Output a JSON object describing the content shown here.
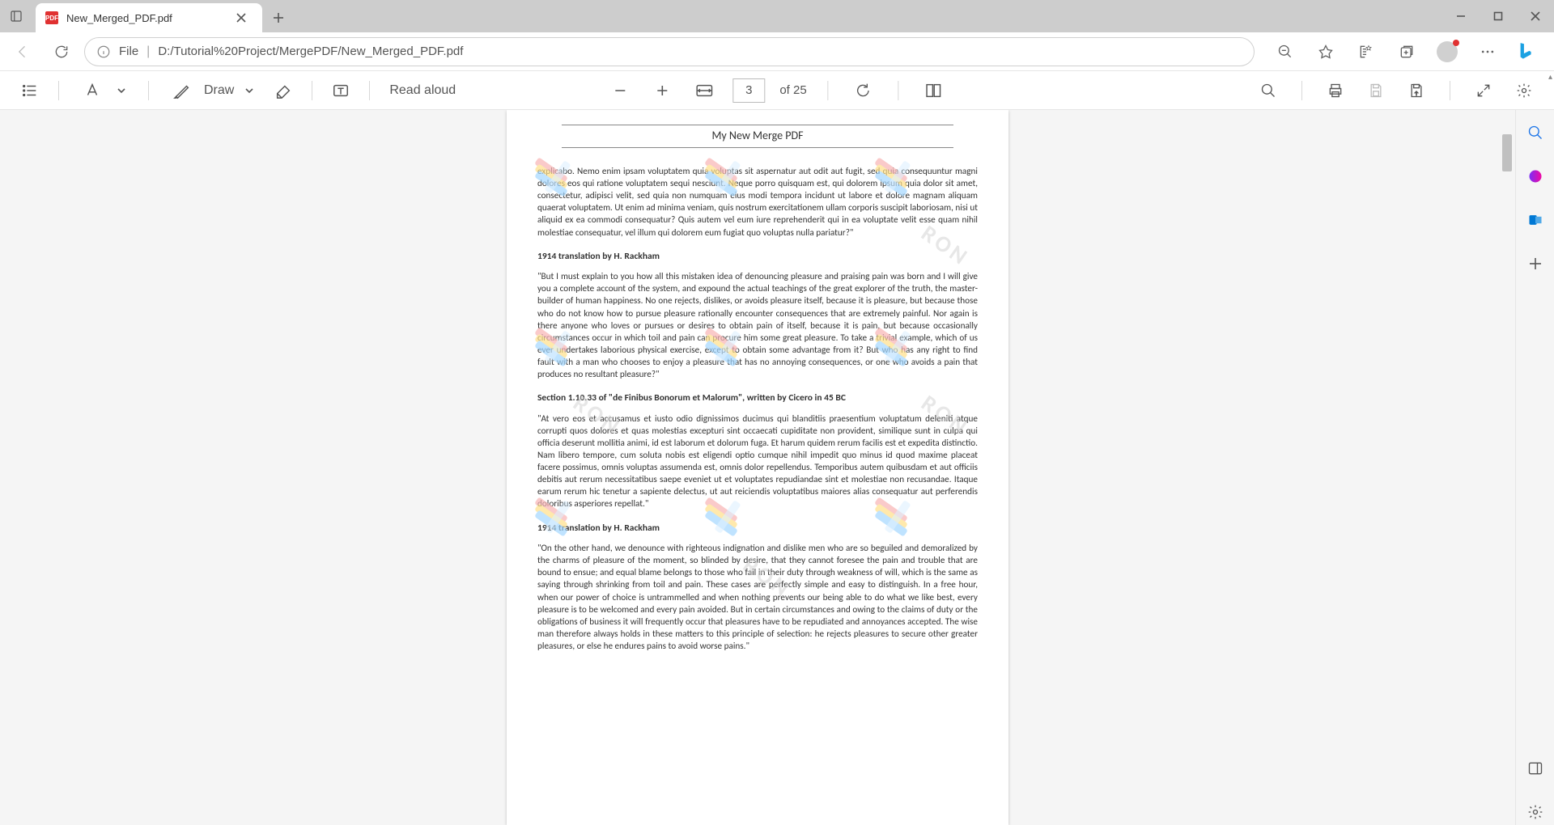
{
  "tab": {
    "title": "New_Merged_PDF.pdf",
    "badge": "PDF"
  },
  "address": {
    "scheme": "File",
    "url": "D:/Tutorial%20Project/MergePDF/New_Merged_PDF.pdf"
  },
  "pdf_toolbar": {
    "draw_label": "Draw",
    "read_aloud_label": "Read aloud",
    "page_current": "3",
    "page_total": "of 25"
  },
  "doc": {
    "header": "My New Merge PDF",
    "p1": "explicabo. Nemo enim ipsam voluptatem quia voluptas sit aspernatur aut odit aut fugit, sed quia consequuntur magni dolores eos qui ratione voluptatem sequi nesciunt. Neque porro quisquam est, qui dolorem ipsum quia dolor sit amet, consectetur, adipisci velit, sed quia non numquam eius modi tempora incidunt ut labore et dolore magnam aliquam quaerat voluptatem. Ut enim ad minima veniam, quis nostrum exercitationem ullam corporis suscipit laboriosam, nisi ut aliquid ex ea commodi consequatur? Quis autem vel eum iure reprehenderit qui in ea voluptate velit esse quam nihil molestiae consequatur, vel illum qui dolorem eum fugiat quo voluptas nulla pariatur?\"",
    "h1": "1914 translation by H. Rackham",
    "p2": "\"But I must explain to you how all this mistaken idea of denouncing pleasure and praising pain was born and I will give you a complete account of the system, and expound the actual teachings of the great explorer of the truth, the master-builder of human happiness. No one rejects, dislikes, or avoids pleasure itself, because it is pleasure, but because those who do not know how to pursue pleasure rationally encounter consequences that are extremely painful. Nor again is there anyone who loves or pursues or desires to obtain pain of itself, because it is pain, but because occasionally circumstances occur in which toil and pain can procure him some great pleasure. To take a trivial example, which of us ever undertakes laborious physical exercise, except to obtain some advantage from it? But who has any right to find fault with a man who chooses to enjoy a pleasure that has no annoying consequences, or one who avoids a pain that produces no resultant pleasure?\"",
    "h2": "Section 1.10.33 of \"de Finibus Bonorum et Malorum\", written by Cicero in 45 BC",
    "p3": "\"At vero eos et accusamus et iusto odio dignissimos ducimus qui blanditiis praesentium voluptatum deleniti atque corrupti quos dolores et quas molestias excepturi sint occaecati cupiditate non provident, similique sunt in culpa qui officia deserunt mollitia animi, id est laborum et dolorum fuga. Et harum quidem rerum facilis est et expedita distinctio. Nam libero tempore, cum soluta nobis est eligendi optio cumque nihil impedit quo minus id quod maxime placeat facere possimus, omnis voluptas assumenda est, omnis dolor repellendus. Temporibus autem quibusdam et aut officiis debitis aut rerum necessitatibus saepe eveniet ut et voluptates repudiandae sint et molestiae non recusandae. Itaque earum rerum hic tenetur a sapiente delectus, ut aut reiciendis voluptatibus maiores alias consequatur aut perferendis doloribus asperiores repellat.\"",
    "h3": "1914 translation by H. Rackham",
    "p4": "\"On the other hand, we denounce with righteous indignation and dislike men who are so beguiled and demoralized by the charms of pleasure of the moment, so blinded by desire, that they cannot foresee the pain and trouble that are bound to ensue; and equal blame belongs to those who fail in their duty through weakness of will, which is the same as saying through shrinking from toil and pain. These cases are perfectly simple and easy to distinguish. In a free hour, when our power of choice is untrammelled and when nothing prevents our being able to do what we like best, every pleasure is to be welcomed and every pain avoided. But in certain circumstances and owing to the claims of duty or the obligations of business it will frequently occur that pleasures have to be repudiated and annoyances accepted. The wise man therefore always holds in these matters to this principle of selection: he rejects pleasures to secure other greater pleasures, or else he endures pains to avoid worse pains.\"",
    "watermark_text": "RON"
  }
}
